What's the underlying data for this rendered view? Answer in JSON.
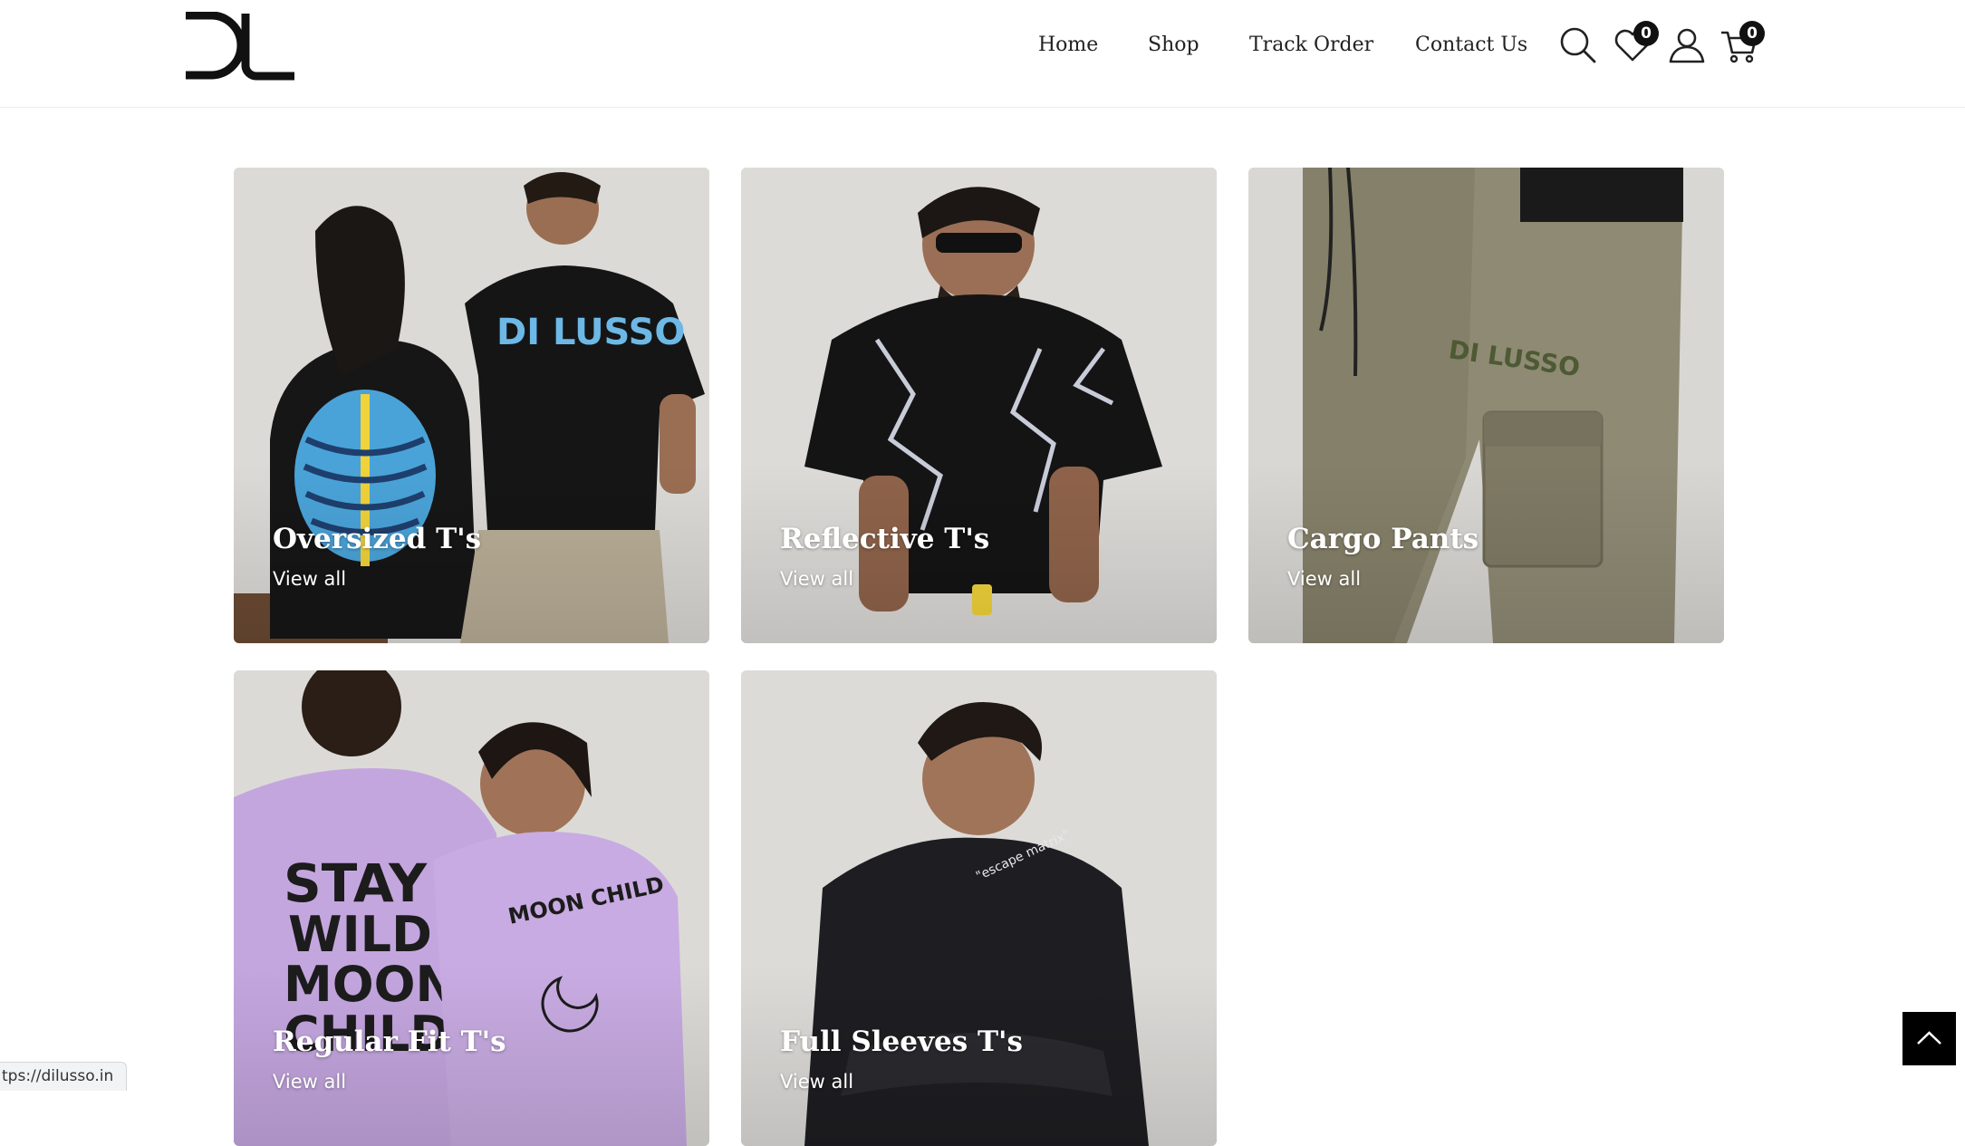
{
  "header": {
    "logo_alt": "DL",
    "nav": [
      {
        "label": "Home"
      },
      {
        "label": "Shop"
      },
      {
        "label": "Track Order"
      },
      {
        "label": "Contact Us"
      }
    ],
    "wishlist_count": "0",
    "cart_count": "0"
  },
  "icons": {
    "search": "search-icon",
    "wishlist": "heart-icon",
    "account": "user-icon",
    "cart": "cart-icon",
    "back_to_top": "chevron-up-icon"
  },
  "categories": [
    {
      "title": "Oversized T's",
      "link": "View all"
    },
    {
      "title": "Reflective T's",
      "link": "View all"
    },
    {
      "title": "Cargo Pants",
      "link": "View all"
    },
    {
      "title": "Regular Fit T's",
      "link": "View all"
    },
    {
      "title": "Full Sleeves T's",
      "link": "View all"
    }
  ],
  "status_bar": {
    "url": "tps://dilusso.in"
  },
  "colors": {
    "text": "#222222",
    "badge": "#111111",
    "tile_background": "#d8d6d2",
    "back_to_top": "#000000"
  }
}
